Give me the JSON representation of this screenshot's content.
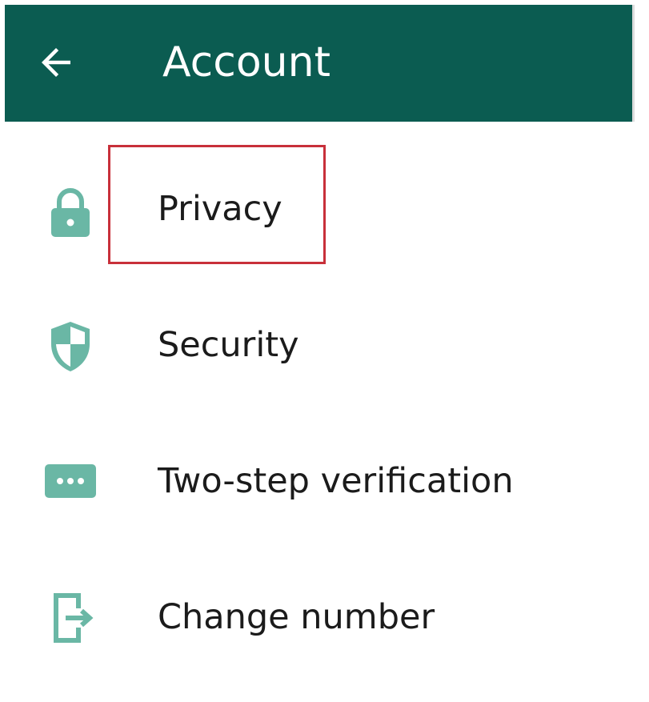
{
  "header": {
    "title": "Account",
    "background_color": "#0b5c51",
    "back_icon": "arrow-left-icon"
  },
  "menu": {
    "items": [
      {
        "label": "Privacy",
        "icon": "lock-icon"
      },
      {
        "label": "Security",
        "icon": "shield-icon"
      },
      {
        "label": "Two-step verification",
        "icon": "dots-password-icon"
      },
      {
        "label": "Change number",
        "icon": "change-number-icon"
      }
    ],
    "icon_color": "#6ab7a5",
    "highlighted_item": "Privacy",
    "highlight_color": "#c8303a"
  }
}
